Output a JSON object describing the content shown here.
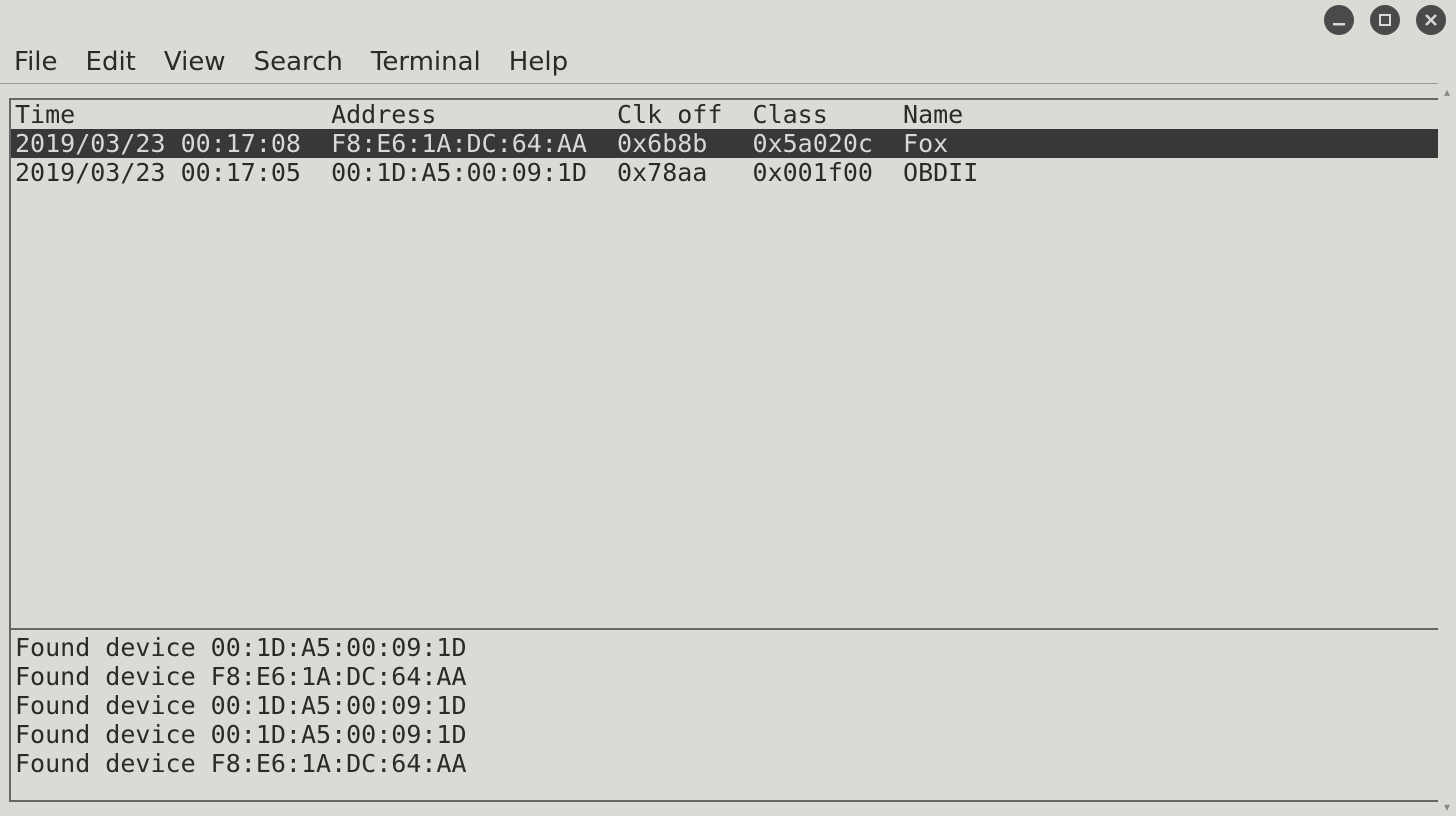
{
  "window": {
    "minimize": "minimize",
    "maximize": "maximize",
    "close": "close"
  },
  "menubar": {
    "items": [
      {
        "label": "File"
      },
      {
        "label": "Edit"
      },
      {
        "label": "View"
      },
      {
        "label": "Search"
      },
      {
        "label": "Terminal"
      },
      {
        "label": "Help"
      }
    ]
  },
  "table": {
    "headers": {
      "time": "Time",
      "address": "Address",
      "clk_off": "Clk off",
      "class": "Class",
      "name": "Name"
    },
    "rows": [
      {
        "time": "2019/03/23 00:17:08",
        "address": "F8:E6:1A:DC:64:AA",
        "clk_off": "0x6b8b",
        "class": "0x5a020c",
        "name": "Fox",
        "selected": true
      },
      {
        "time": "2019/03/23 00:17:05",
        "address": "00:1D:A5:00:09:1D",
        "clk_off": "0x78aa",
        "class": "0x001f00",
        "name": "OBDII",
        "selected": false
      }
    ]
  },
  "log": {
    "lines": [
      "Found device 00:1D:A5:00:09:1D",
      "Found device F8:E6:1A:DC:64:AA",
      "Found device 00:1D:A5:00:09:1D",
      "Found device 00:1D:A5:00:09:1D",
      "Found device F8:E6:1A:DC:64:AA"
    ]
  }
}
